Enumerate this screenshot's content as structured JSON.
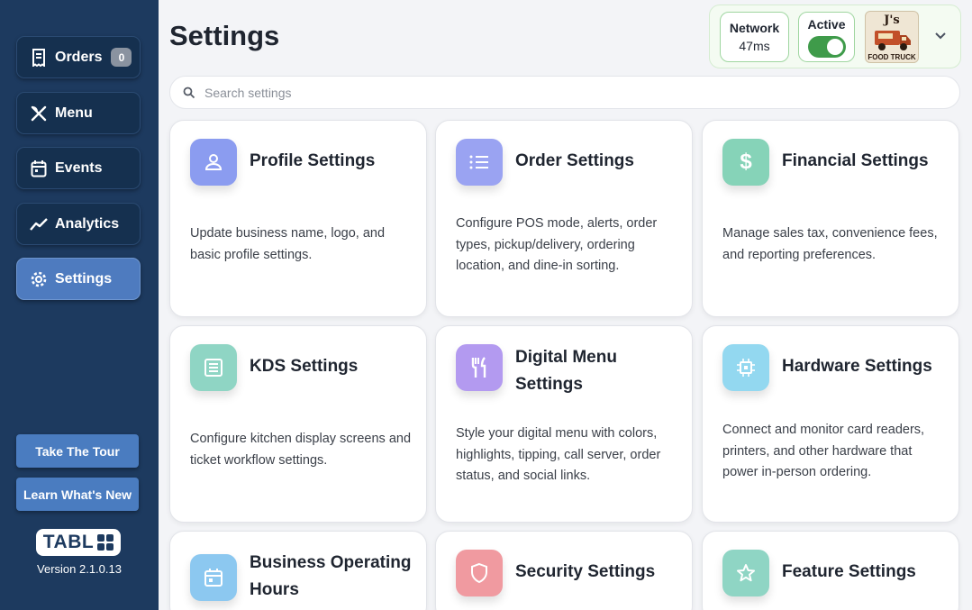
{
  "sidebar": {
    "nav": [
      {
        "label": "Orders",
        "badge": "0",
        "icon": "receipt-icon"
      },
      {
        "label": "Menu",
        "icon": "utensils-icon"
      },
      {
        "label": "Events",
        "icon": "calendar-icon"
      },
      {
        "label": "Analytics",
        "icon": "chart-line-icon"
      },
      {
        "label": "Settings",
        "icon": "gear-icon",
        "active": true
      }
    ],
    "tour_label": "Take The Tour",
    "whats_new_label": "Learn What's New",
    "logo_text": "TABL",
    "version": "Version 2.1.0.13"
  },
  "header": {
    "title": "Settings",
    "network_label": "Network",
    "network_value": "47ms",
    "active_label": "Active",
    "brand_top": "J's",
    "brand_bottom": "FOOD TRUCK"
  },
  "search": {
    "placeholder": "Search settings",
    "value": ""
  },
  "cards": [
    {
      "title": "Profile Settings",
      "desc": "Update business name, logo, and basic profile settings.",
      "icon": "user-icon",
      "color": "#8b9cf0"
    },
    {
      "title": "Order Settings",
      "desc": "Configure POS mode, alerts, order types, pickup/delivery, ordering location, and dine-in sorting.",
      "icon": "list-icon",
      "color": "#9aa3f2"
    },
    {
      "title": "Financial Settings",
      "desc": "Manage sales tax, convenience fees, and reporting preferences.",
      "icon": "dollar-icon",
      "color": "#86d3b8"
    },
    {
      "title": "KDS Settings",
      "desc": "Configure kitchen display screens and ticket workflow settings.",
      "icon": "kds-icon",
      "color": "#8fd5c4"
    },
    {
      "title": "Digital Menu Settings",
      "desc": "Style your digital menu with colors, highlights, tipping, call server, order status, and social links.",
      "icon": "fork-knife-icon",
      "color": "#b39af0"
    },
    {
      "title": "Hardware Settings",
      "desc": "Connect and monitor card readers, printers, and other hardware that power in-person ordering.",
      "icon": "chip-icon",
      "color": "#93d8f0"
    },
    {
      "title": "Business Operating Hours",
      "desc": "",
      "icon": "calendar-icon",
      "color": "#8cc8f0"
    },
    {
      "title": "Security Settings",
      "desc": "",
      "icon": "shield-icon",
      "color": "#f09aa0"
    },
    {
      "title": "Feature Settings",
      "desc": "",
      "icon": "star-icon",
      "color": "#8fd5c4"
    }
  ]
}
